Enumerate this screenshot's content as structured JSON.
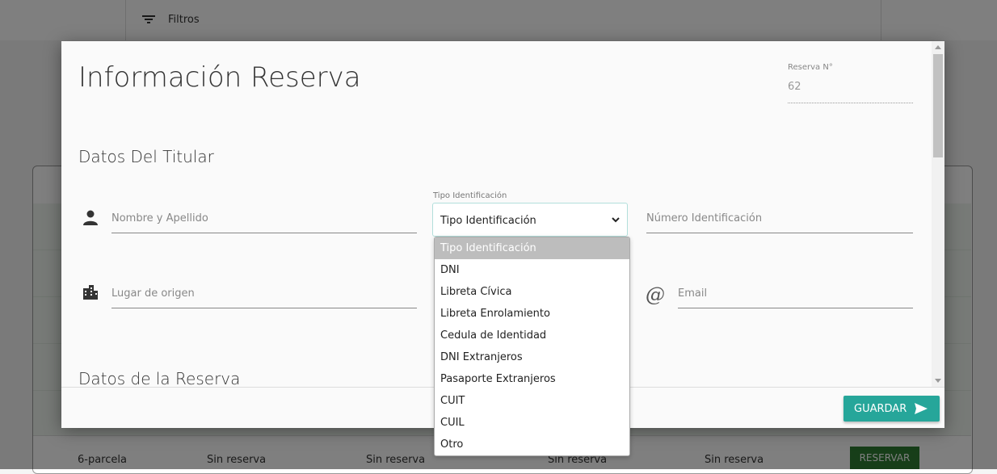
{
  "background": {
    "filters_label": "Filtros",
    "last_row": {
      "name": "6-parcela",
      "cells": [
        "Sin reserva",
        "Sin reserva",
        "Sin reserva",
        "Sin reserva"
      ],
      "action": "RESERVAR"
    }
  },
  "modal": {
    "title": "Información Reserva",
    "reserva_label": "Reserva N°",
    "reserva_value": "62",
    "section_titular": "Datos Del Titular",
    "section_reserva": "Datos de la Reserva",
    "fields": {
      "nombre_placeholder": "Nombre y Apellido",
      "tipo_label": "Tipo Identificación",
      "tipo_value": "Tipo Identificación",
      "numero_placeholder": "Número Identificación",
      "lugar_placeholder": "Lugar de origen",
      "email_placeholder": "Email",
      "email_icon": "@"
    },
    "save_label": "GUARDAR"
  },
  "dropdown": {
    "options": [
      "Tipo Identificación",
      "DNI",
      "Libreta Cívica",
      "Libreta Enrolamiento",
      "Cedula de Identidad",
      "DNI Extranjeros",
      "Pasaporte Extranjeros",
      "CUIT",
      "CUIL",
      "Otro"
    ],
    "selected_index": 0
  },
  "colors": {
    "accent": "#26a69a",
    "reservar": "#2e7d32"
  }
}
